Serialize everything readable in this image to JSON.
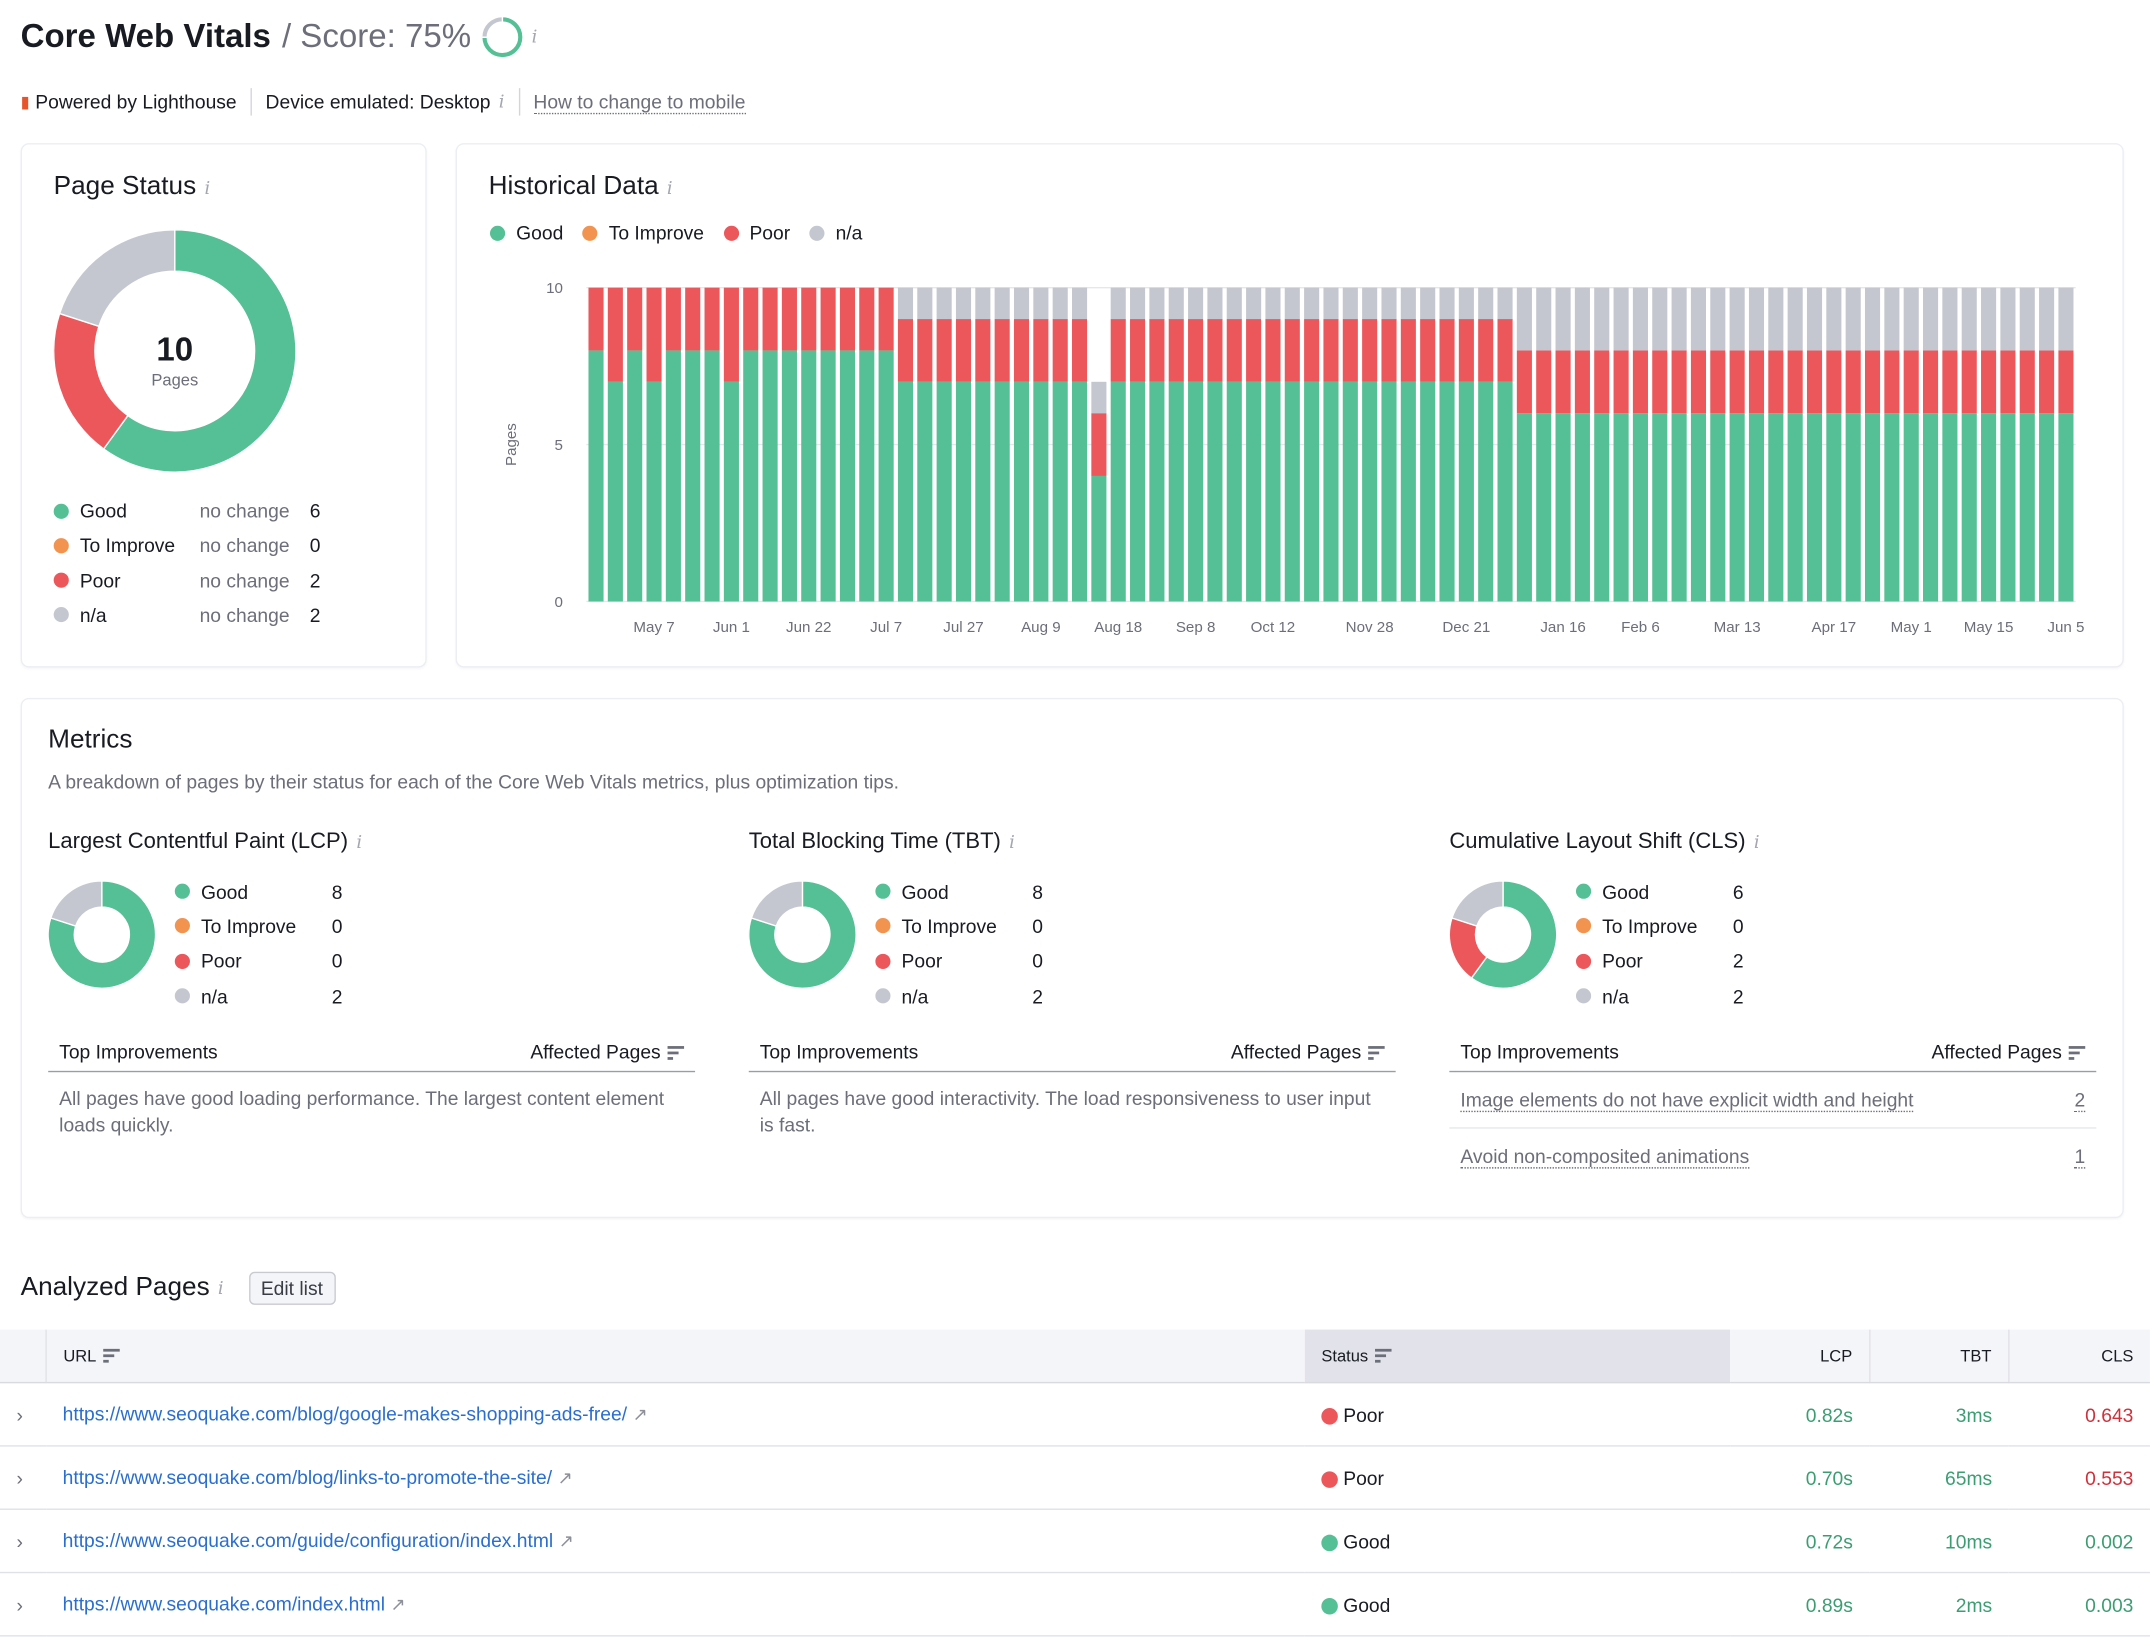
{
  "header": {
    "title": "Core Web Vitals",
    "score_text": "/ Score: 75%",
    "score_value": 75,
    "powered_by": "Powered by Lighthouse",
    "device": "Device emulated: Desktop",
    "mobile_link": "How to change to mobile"
  },
  "colors": {
    "good": "#55bf95",
    "to_improve": "#f29450",
    "poor": "#eb575b",
    "na": "#c4c7cf"
  },
  "page_status": {
    "title": "Page Status",
    "total": "10",
    "total_label": "Pages",
    "items": [
      {
        "label": "Good",
        "change": "no change",
        "value": 6,
        "key": "good"
      },
      {
        "label": "To Improve",
        "change": "no change",
        "value": 0,
        "key": "to_improve"
      },
      {
        "label": "Poor",
        "change": "no change",
        "value": 2,
        "key": "poor"
      },
      {
        "label": "n/a",
        "change": "no change",
        "value": 2,
        "key": "na"
      }
    ]
  },
  "chart_data": {
    "type": "bar",
    "stacked": true,
    "title": "Historical Data",
    "ylabel": "Pages",
    "ylim": [
      0,
      10
    ],
    "yticks": [
      0,
      5,
      10
    ],
    "legend": [
      "Good",
      "To Improve",
      "Poor",
      "n/a"
    ],
    "legend_position": "top-left",
    "x_tick_labels": [
      {
        "bar": 3,
        "label": "May 7"
      },
      {
        "bar": 7,
        "label": "Jun 1"
      },
      {
        "bar": 11,
        "label": "Jun 22"
      },
      {
        "bar": 15,
        "label": "Jul 7"
      },
      {
        "bar": 19,
        "label": "Jul 27"
      },
      {
        "bar": 23,
        "label": "Aug 9"
      },
      {
        "bar": 27,
        "label": "Aug 18"
      },
      {
        "bar": 31,
        "label": "Sep 8"
      },
      {
        "bar": 35,
        "label": "Oct 12"
      },
      {
        "bar": 40,
        "label": "Nov 28"
      },
      {
        "bar": 45,
        "label": "Dec 21"
      },
      {
        "bar": 50,
        "label": "Jan 16"
      },
      {
        "bar": 54,
        "label": "Feb 6"
      },
      {
        "bar": 59,
        "label": "Mar 13"
      },
      {
        "bar": 64,
        "label": "Apr 17"
      },
      {
        "bar": 68,
        "label": "May 1"
      },
      {
        "bar": 72,
        "label": "May 15"
      },
      {
        "bar": 76,
        "label": "Jun 5"
      }
    ],
    "series": [
      {
        "name": "Good",
        "values": [
          8,
          7,
          8,
          7,
          8,
          8,
          8,
          7,
          8,
          8,
          8,
          8,
          8,
          8,
          8,
          8,
          7,
          7,
          7,
          7,
          7,
          7,
          7,
          7,
          7,
          7,
          4,
          7,
          7,
          7,
          7,
          7,
          7,
          7,
          7,
          7,
          7,
          7,
          7,
          7,
          7,
          7,
          7,
          7,
          7,
          7,
          7,
          7,
          6,
          6,
          6,
          6,
          6,
          6,
          6,
          6,
          6,
          6,
          6,
          6,
          6,
          6,
          6,
          6,
          6,
          6,
          6,
          6,
          6,
          6,
          6,
          6,
          6,
          6,
          6,
          6,
          6
        ]
      },
      {
        "name": "To Improve",
        "values": [
          0,
          0,
          0,
          0,
          0,
          0,
          0,
          0,
          0,
          0,
          0,
          0,
          0,
          0,
          0,
          0,
          0,
          0,
          0,
          0,
          0,
          0,
          0,
          0,
          0,
          0,
          0,
          0,
          0,
          0,
          0,
          0,
          0,
          0,
          0,
          0,
          0,
          0,
          0,
          0,
          0,
          0,
          0,
          0,
          0,
          0,
          0,
          0,
          0,
          0,
          0,
          0,
          0,
          0,
          0,
          0,
          0,
          0,
          0,
          0,
          0,
          0,
          0,
          0,
          0,
          0,
          0,
          0,
          0,
          0,
          0,
          0,
          0,
          0,
          0,
          0,
          0
        ]
      },
      {
        "name": "Poor",
        "values": [
          2,
          3,
          2,
          3,
          2,
          2,
          2,
          3,
          2,
          2,
          2,
          2,
          2,
          2,
          2,
          2,
          2,
          2,
          2,
          2,
          2,
          2,
          2,
          2,
          2,
          2,
          2,
          2,
          2,
          2,
          2,
          2,
          2,
          2,
          2,
          2,
          2,
          2,
          2,
          2,
          2,
          2,
          2,
          2,
          2,
          2,
          2,
          2,
          2,
          2,
          2,
          2,
          2,
          2,
          2,
          2,
          2,
          2,
          2,
          2,
          2,
          2,
          2,
          2,
          2,
          2,
          2,
          2,
          2,
          2,
          2,
          2,
          2,
          2,
          2,
          2,
          2
        ]
      },
      {
        "name": "n/a",
        "values": [
          0,
          0,
          0,
          0,
          0,
          0,
          0,
          0,
          0,
          0,
          0,
          0,
          0,
          0,
          0,
          0,
          1,
          1,
          1,
          1,
          1,
          1,
          1,
          1,
          1,
          1,
          1,
          1,
          1,
          1,
          1,
          1,
          1,
          1,
          1,
          1,
          1,
          1,
          1,
          1,
          1,
          1,
          1,
          1,
          1,
          1,
          1,
          1,
          2,
          2,
          2,
          2,
          2,
          2,
          2,
          2,
          2,
          2,
          2,
          2,
          2,
          2,
          2,
          2,
          2,
          2,
          2,
          2,
          2,
          2,
          2,
          2,
          2,
          2,
          2,
          2,
          2
        ]
      }
    ]
  },
  "metrics": {
    "title": "Metrics",
    "description": "A breakdown of pages by their status for each of the Core Web Vitals metrics, plus optimization tips.",
    "col_improvements": "Top Improvements",
    "col_affected": "Affected Pages",
    "cards": [
      {
        "title": "Largest Contentful Paint (LCP)",
        "counts": [
          8,
          0,
          0,
          2
        ],
        "labels": [
          "Good",
          "To Improve",
          "Poor",
          "n/a"
        ],
        "message": "All pages have good loading performance. The largest content element loads quickly.",
        "improvements": []
      },
      {
        "title": "Total Blocking Time (TBT)",
        "counts": [
          8,
          0,
          0,
          2
        ],
        "labels": [
          "Good",
          "To Improve",
          "Poor",
          "n/a"
        ],
        "message": "All pages have good interactivity. The load responsiveness to user input is fast.",
        "improvements": []
      },
      {
        "title": "Cumulative Layout Shift (CLS)",
        "counts": [
          6,
          0,
          2,
          2
        ],
        "labels": [
          "Good",
          "To Improve",
          "Poor",
          "n/a"
        ],
        "message": "",
        "improvements": [
          {
            "text": "Image elements do not have explicit width and height",
            "pages": "2"
          },
          {
            "text": "Avoid non-composited animations",
            "pages": "1"
          }
        ]
      }
    ]
  },
  "analyzed": {
    "title": "Analyzed Pages",
    "edit_button": "Edit list",
    "columns": {
      "url": "URL",
      "status": "Status",
      "lcp": "LCP",
      "tbt": "TBT",
      "cls": "CLS"
    },
    "rows": [
      {
        "url": "https://www.seoquake.com/blog/google-makes-shopping-ads-free/",
        "status": "Poor",
        "lcp": "0.82s",
        "tbt": "3ms",
        "cls": "0.643",
        "cls_poor": true
      },
      {
        "url": "https://www.seoquake.com/blog/links-to-promote-the-site/",
        "status": "Poor",
        "lcp": "0.70s",
        "tbt": "65ms",
        "cls": "0.553",
        "cls_poor": true
      },
      {
        "url": "https://www.seoquake.com/guide/configuration/index.html",
        "status": "Good",
        "lcp": "0.72s",
        "tbt": "10ms",
        "cls": "0.002",
        "cls_poor": false
      },
      {
        "url": "https://www.seoquake.com/index.html",
        "status": "Good",
        "lcp": "0.89s",
        "tbt": "2ms",
        "cls": "0.003",
        "cls_poor": false
      }
    ]
  }
}
